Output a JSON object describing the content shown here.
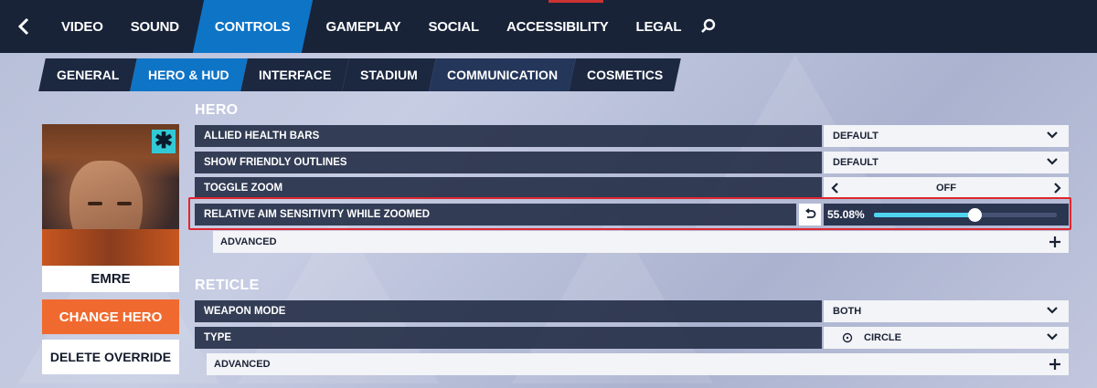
{
  "topnav": {
    "tabs": [
      "VIDEO",
      "SOUND",
      "CONTROLS",
      "GAMEPLAY",
      "SOCIAL",
      "ACCESSIBILITY",
      "LEGAL"
    ],
    "active_tab": "CONTROLS"
  },
  "subnav": {
    "tabs": [
      "GENERAL",
      "HERO & HUD",
      "INTERFACE",
      "STADIUM",
      "COMMUNICATION",
      "COSMETICS"
    ],
    "active_tab": "HERO & HUD"
  },
  "hero": {
    "name": "EMRE",
    "badge": "✱",
    "change_label": "CHANGE HERO",
    "delete_label": "DELETE OVERRIDE"
  },
  "hero_section": {
    "title": "HERO",
    "allied_health_bars": {
      "label": "ALLIED HEALTH BARS",
      "value": "DEFAULT"
    },
    "show_friendly_outlines": {
      "label": "SHOW FRIENDLY OUTLINES",
      "value": "DEFAULT"
    },
    "toggle_zoom": {
      "label": "TOGGLE ZOOM",
      "value": "OFF"
    },
    "aim_sensitivity": {
      "label": "RELATIVE AIM SENSITIVITY WHILE ZOOMED",
      "value_text": "55.08%",
      "value": 55.08
    },
    "advanced_label": "ADVANCED"
  },
  "reticle_section": {
    "title": "RETICLE",
    "weapon_mode": {
      "label": "WEAPON MODE",
      "value": "BOTH"
    },
    "type": {
      "label": "TYPE",
      "value": "CIRCLE"
    },
    "advanced_label": "ADVANCED"
  },
  "colors": {
    "accent_blue": "#0e74c6",
    "orange": "#f06a2f",
    "slider_cyan": "#4fd4ee",
    "highlight_red": "#e0262e"
  }
}
